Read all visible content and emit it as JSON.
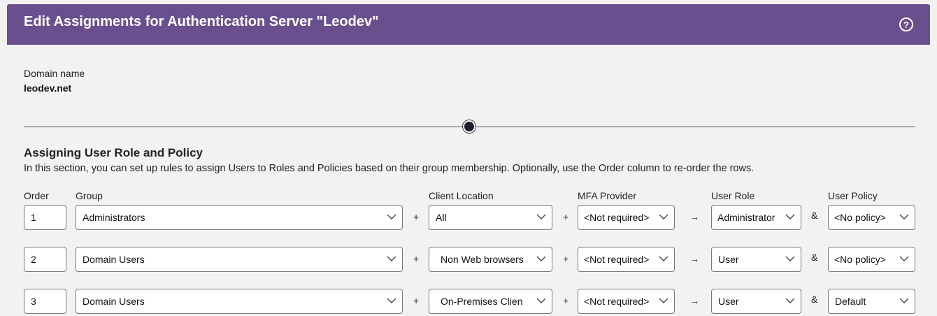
{
  "header": {
    "title": "Edit Assignments for Authentication Server \"Leodev\"",
    "help_icon": "help-icon",
    "help_glyph": "?"
  },
  "domain": {
    "label": "Domain name",
    "value": "leodev.net"
  },
  "section": {
    "title": "Assigning User Role and Policy",
    "description": "In this section, you can set up rules to assign Users to Roles and Policies based on their group membership. Optionally, use the Order column to re-order the rows."
  },
  "columns": {
    "order": "Order",
    "group": "Group",
    "client_location": "Client Location",
    "mfa_provider": "MFA Provider",
    "user_role": "User Role",
    "user_policy": "User Policy"
  },
  "operators": {
    "plus": "+",
    "arrow": "→",
    "and": "&"
  },
  "rows": [
    {
      "order": "1",
      "group": "Administrators",
      "client_location": "All",
      "mfa_provider": "<Not required>",
      "user_role": "Administrator",
      "user_policy": "<No policy>"
    },
    {
      "order": "2",
      "group": "Domain Users",
      "client_location": "Non Web browsers",
      "mfa_provider": "<Not required>",
      "user_role": "User",
      "user_policy": "<No policy>"
    },
    {
      "order": "3",
      "group": "Domain Users",
      "client_location": "On-Premises Clien",
      "mfa_provider": "<Not required>",
      "user_role": "User",
      "user_policy": "Default"
    }
  ],
  "colors": {
    "header_bg": "#6a4f8e",
    "page_bg": "#f2f2f2"
  }
}
